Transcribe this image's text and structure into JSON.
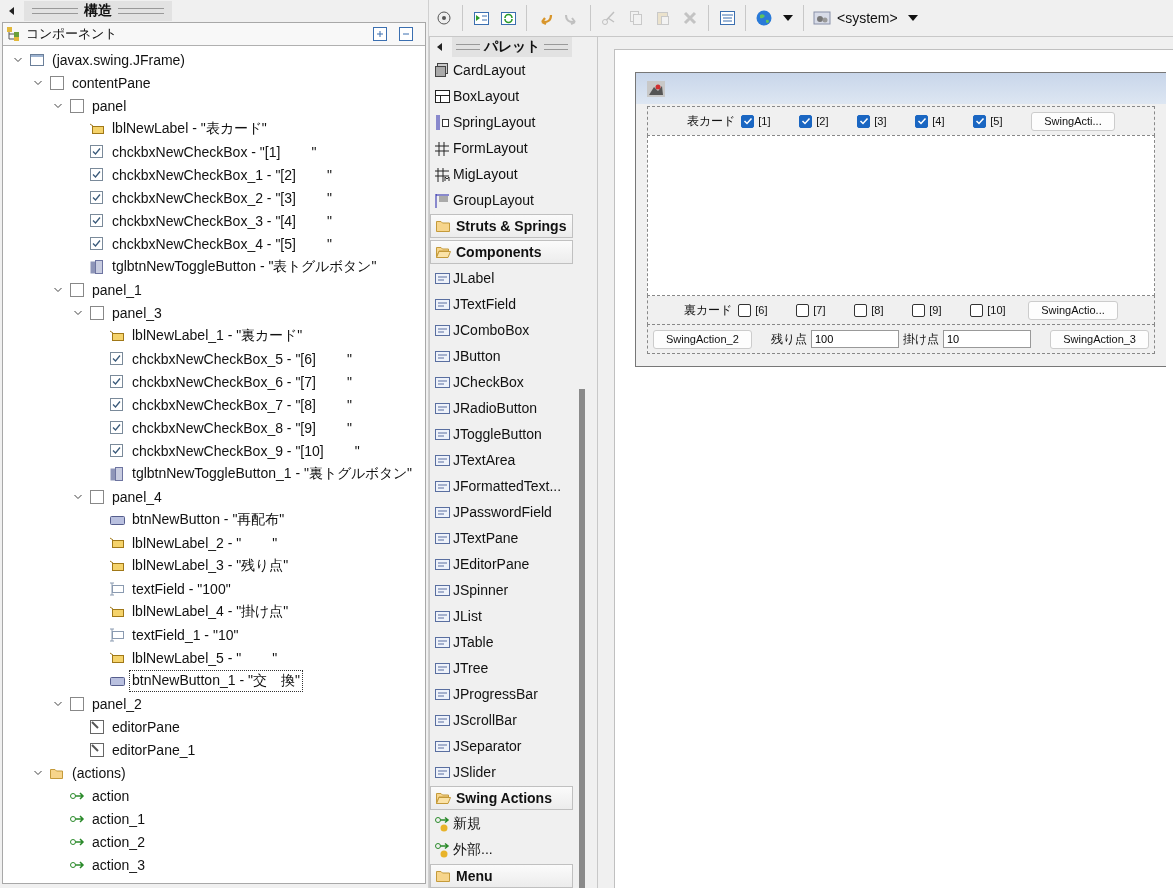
{
  "structure_view": {
    "title": "構造",
    "components_header": "コンポーネント",
    "tree": [
      {
        "label": "(javax.swing.JFrame)",
        "kind": "frame",
        "expanded": true,
        "selected": false,
        "children": [
          {
            "label": "contentPane",
            "kind": "panel",
            "expanded": true,
            "selected": false,
            "children": [
              {
                "label": "panel",
                "kind": "panel",
                "expanded": true,
                "selected": false,
                "children": [
                  {
                    "label": "lblNewLabel - \"表カード\"",
                    "kind": "label",
                    "selected": false
                  },
                  {
                    "label": "chckbxNewCheckBox - \"[1]        \"",
                    "kind": "checkbox",
                    "selected": false
                  },
                  {
                    "label": "chckbxNewCheckBox_1 - \"[2]        \"",
                    "kind": "checkbox",
                    "selected": false
                  },
                  {
                    "label": "chckbxNewCheckBox_2 - \"[3]        \"",
                    "kind": "checkbox",
                    "selected": false
                  },
                  {
                    "label": "chckbxNewCheckBox_3 - \"[4]        \"",
                    "kind": "checkbox",
                    "selected": false
                  },
                  {
                    "label": "chckbxNewCheckBox_4 - \"[5]        \"",
                    "kind": "checkbox",
                    "selected": false
                  },
                  {
                    "label": "tglbtnNewToggleButton - \"表トグルボタン\"",
                    "kind": "toggle",
                    "selected": false
                  }
                ]
              },
              {
                "label": "panel_1",
                "kind": "panel",
                "expanded": true,
                "selected": false,
                "children": [
                  {
                    "label": "panel_3",
                    "kind": "panel",
                    "expanded": true,
                    "selected": false,
                    "children": [
                      {
                        "label": "lblNewLabel_1 - \"裏カード\"",
                        "kind": "label",
                        "selected": false
                      },
                      {
                        "label": "chckbxNewCheckBox_5 - \"[6]        \"",
                        "kind": "checkbox",
                        "selected": false
                      },
                      {
                        "label": "chckbxNewCheckBox_6 - \"[7]        \"",
                        "kind": "checkbox",
                        "selected": false
                      },
                      {
                        "label": "chckbxNewCheckBox_7 - \"[8]        \"",
                        "kind": "checkbox",
                        "selected": false
                      },
                      {
                        "label": "chckbxNewCheckBox_8 - \"[9]        \"",
                        "kind": "checkbox",
                        "selected": false
                      },
                      {
                        "label": "chckbxNewCheckBox_9 - \"[10]        \"",
                        "kind": "checkbox",
                        "selected": false
                      },
                      {
                        "label": "tglbtnNewToggleButton_1 - \"裏トグルボタン\"",
                        "kind": "toggle",
                        "selected": false
                      }
                    ]
                  },
                  {
                    "label": "panel_4",
                    "kind": "panel",
                    "expanded": true,
                    "selected": false,
                    "children": [
                      {
                        "label": "btnNewButton - \"再配布\"",
                        "kind": "button",
                        "selected": false
                      },
                      {
                        "label": "lblNewLabel_2 - \"        \"",
                        "kind": "label",
                        "selected": false
                      },
                      {
                        "label": "lblNewLabel_3 - \"残り点\"",
                        "kind": "label",
                        "selected": false
                      },
                      {
                        "label": "textField - \"100\"",
                        "kind": "textfield",
                        "selected": false
                      },
                      {
                        "label": "lblNewLabel_4 - \"掛け点\"",
                        "kind": "label",
                        "selected": false
                      },
                      {
                        "label": "textField_1 - \"10\"",
                        "kind": "textfield",
                        "selected": false
                      },
                      {
                        "label": "lblNewLabel_5 - \"        \"",
                        "kind": "label",
                        "selected": false
                      },
                      {
                        "label": "btnNewButton_1 - \"交　換\"",
                        "kind": "button",
                        "selected": true
                      }
                    ]
                  }
                ]
              },
              {
                "label": "panel_2",
                "kind": "panel",
                "expanded": true,
                "selected": false,
                "children": [
                  {
                    "label": "editorPane",
                    "kind": "editor",
                    "selected": false
                  },
                  {
                    "label": "editorPane_1",
                    "kind": "editor",
                    "selected": false
                  }
                ]
              }
            ]
          },
          {
            "label": "(actions)",
            "kind": "folder",
            "expanded": true,
            "selected": false,
            "children": [
              {
                "label": "action",
                "kind": "action",
                "selected": false
              },
              {
                "label": "action_1",
                "kind": "action",
                "selected": false
              },
              {
                "label": "action_2",
                "kind": "action",
                "selected": false
              },
              {
                "label": "action_3",
                "kind": "action",
                "selected": false
              }
            ]
          }
        ]
      }
    ]
  },
  "toolbar": {
    "buttons": [
      {
        "disabled": false
      },
      {
        "disabled": false
      },
      {
        "disabled": false
      },
      {
        "disabled": false
      },
      {
        "disabled": true
      },
      {
        "disabled": true
      },
      {
        "disabled": true
      },
      {
        "disabled": true
      },
      {
        "disabled": true
      },
      {
        "disabled": false
      },
      {
        "disabled": false
      }
    ],
    "look_and_feel": "<system>"
  },
  "palette": {
    "title": "パレット",
    "items": [
      {
        "label": "CardLayout",
        "kind": "layout"
      },
      {
        "label": "BoxLayout",
        "kind": "layout"
      },
      {
        "label": "SpringLayout",
        "kind": "layout"
      },
      {
        "label": "FormLayout",
        "kind": "layout"
      },
      {
        "label": "MigLayout",
        "kind": "layout"
      },
      {
        "label": "GroupLayout",
        "kind": "layout"
      },
      {
        "label": "Struts & Springs",
        "kind": "category",
        "expanded": false
      },
      {
        "label": "Components",
        "kind": "category",
        "expanded": true
      },
      {
        "label": "JLabel",
        "kind": "component"
      },
      {
        "label": "JTextField",
        "kind": "component"
      },
      {
        "label": "JComboBox",
        "kind": "component"
      },
      {
        "label": "JButton",
        "kind": "component"
      },
      {
        "label": "JCheckBox",
        "kind": "component"
      },
      {
        "label": "JRadioButton",
        "kind": "component"
      },
      {
        "label": "JToggleButton",
        "kind": "component"
      },
      {
        "label": "JTextArea",
        "kind": "component"
      },
      {
        "label": "JFormattedText...",
        "kind": "component"
      },
      {
        "label": "JPasswordField",
        "kind": "component"
      },
      {
        "label": "JTextPane",
        "kind": "component"
      },
      {
        "label": "JEditorPane",
        "kind": "component"
      },
      {
        "label": "JSpinner",
        "kind": "component"
      },
      {
        "label": "JList",
        "kind": "component"
      },
      {
        "label": "JTable",
        "kind": "component"
      },
      {
        "label": "JTree",
        "kind": "component"
      },
      {
        "label": "JProgressBar",
        "kind": "component"
      },
      {
        "label": "JScrollBar",
        "kind": "component"
      },
      {
        "label": "JSeparator",
        "kind": "component"
      },
      {
        "label": "JSlider",
        "kind": "component"
      },
      {
        "label": "Swing Actions",
        "kind": "category",
        "expanded": true
      },
      {
        "label": "新規",
        "kind": "action"
      },
      {
        "label": "外部...",
        "kind": "action"
      },
      {
        "label": "Menu",
        "kind": "category",
        "expanded": false
      }
    ]
  },
  "design": {
    "panels": [
      {
        "kind": "row",
        "items": [
          {
            "kind": "label",
            "text": "表カード"
          },
          {
            "kind": "checkbox",
            "text": "[1]",
            "checked": true
          },
          {
            "kind": "checkbox",
            "text": "[2]",
            "checked": true
          },
          {
            "kind": "checkbox",
            "text": "[3]",
            "checked": true
          },
          {
            "kind": "checkbox",
            "text": "[4]",
            "checked": true
          },
          {
            "kind": "checkbox",
            "text": "[5]",
            "checked": true
          },
          {
            "kind": "button",
            "text": "SwingActi..."
          }
        ]
      },
      {
        "kind": "area"
      },
      {
        "kind": "row",
        "items": [
          {
            "kind": "label",
            "text": "裏カード"
          },
          {
            "kind": "checkbox",
            "text": "[6]",
            "checked": false
          },
          {
            "kind": "checkbox",
            "text": "[7]",
            "checked": false
          },
          {
            "kind": "checkbox",
            "text": "[8]",
            "checked": false
          },
          {
            "kind": "checkbox",
            "text": "[9]",
            "checked": false
          },
          {
            "kind": "checkbox",
            "text": "[10]",
            "checked": false
          },
          {
            "kind": "button",
            "text": "SwingActio..."
          }
        ]
      },
      {
        "kind": "spread",
        "items": [
          {
            "kind": "button",
            "text": "SwingAction_2"
          },
          {
            "kind": "label",
            "text": "残り点"
          },
          {
            "kind": "field",
            "value": "100"
          },
          {
            "kind": "label",
            "text": "掛け点"
          },
          {
            "kind": "field",
            "value": "10"
          },
          {
            "kind": "button",
            "text": "SwingAction_3"
          }
        ]
      }
    ]
  }
}
